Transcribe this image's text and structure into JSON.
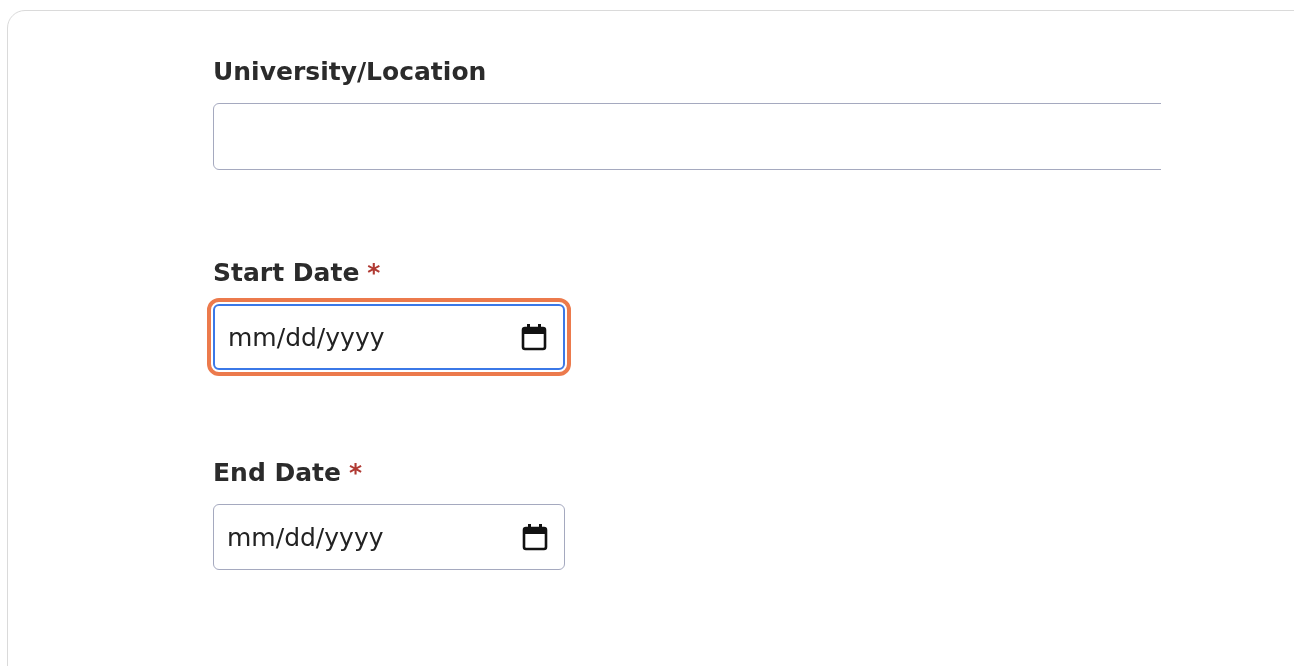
{
  "fields": [
    {
      "kind": "text",
      "label": "University/Location",
      "focused": false
    },
    {
      "kind": "date",
      "label": "Start Date",
      "required_mark": "*",
      "placeholder": "mm/dd/yyyy",
      "focused": true
    },
    {
      "kind": "date",
      "label": "End Date",
      "required_mark": "*",
      "placeholder": "mm/dd/yyyy",
      "focused": false
    }
  ]
}
